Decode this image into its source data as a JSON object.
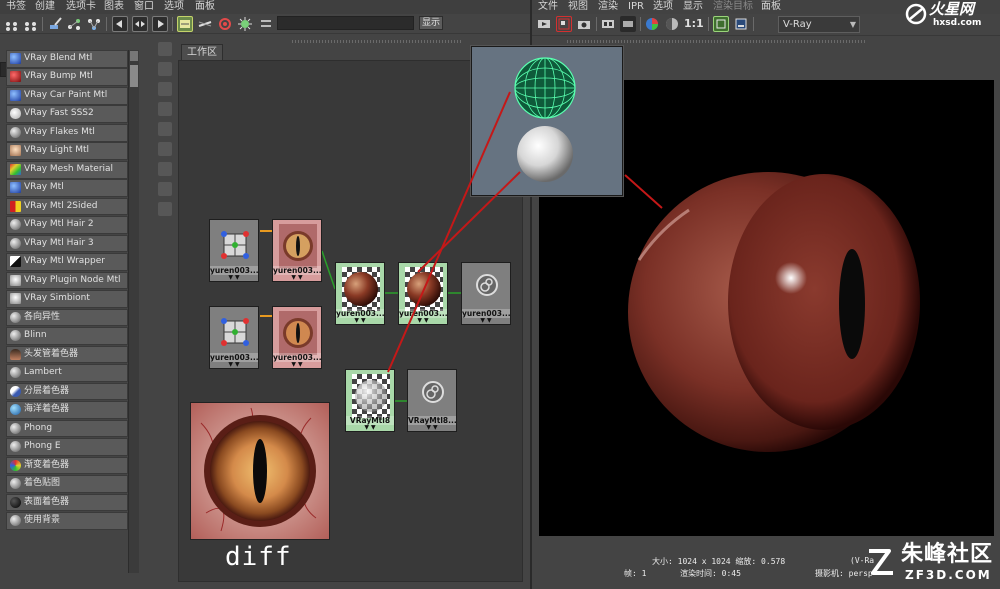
{
  "hypershade": {
    "menu": [
      "书签",
      "创建",
      "选项卡",
      "图表",
      "窗口",
      "选项",
      "面板"
    ],
    "search_button": "显示",
    "workspace_tab": "工作区",
    "shader_list": [
      {
        "label": "VRay Blend Mtl",
        "icon": "blue-sphere-icon"
      },
      {
        "label": "VRay Bump Mtl",
        "icon": "red-bump-icon"
      },
      {
        "label": "VRay Car Paint Mtl",
        "icon": "blue-sphere-icon"
      },
      {
        "label": "VRay Fast SSS2",
        "icon": "cloud-icon"
      },
      {
        "label": "VRay Flakes Mtl",
        "icon": "grey-sphere-icon"
      },
      {
        "label": "VRay Light Mtl",
        "icon": "face-icon"
      },
      {
        "label": "VRay Mesh Material",
        "icon": "rainbow-icon"
      },
      {
        "label": "VRay Mtl",
        "icon": "blue-sphere-icon"
      },
      {
        "label": "VRay Mtl 2Sided",
        "icon": "red-yellow-icon"
      },
      {
        "label": "VRay Mtl Hair 2",
        "icon": "grey-sphere-icon"
      },
      {
        "label": "VRay Mtl Hair 3",
        "icon": "grey-sphere-icon"
      },
      {
        "label": "VRay Mtl Wrapper",
        "icon": "black-white-icon"
      },
      {
        "label": "VRay Plugin Node Mtl",
        "icon": "plugin-icon"
      },
      {
        "label": "VRay Simbiont",
        "icon": "plugin-icon"
      },
      {
        "label": "各向异性",
        "icon": "grey-sphere-icon"
      },
      {
        "label": "Blinn",
        "icon": "grey-sphere-icon"
      },
      {
        "label": "头发管着色器",
        "icon": "hair-tube-icon"
      },
      {
        "label": "Lambert",
        "icon": "grey-sphere-icon"
      },
      {
        "label": "分层着色器",
        "icon": "layered-icon"
      },
      {
        "label": "海洋着色器",
        "icon": "ocean-icon"
      },
      {
        "label": "Phong",
        "icon": "grey-sphere-icon"
      },
      {
        "label": "Phong E",
        "icon": "grey-sphere-icon"
      },
      {
        "label": "渐变着色器",
        "icon": "ramp-icon"
      },
      {
        "label": "着色贴图",
        "icon": "grey-sphere-icon"
      },
      {
        "label": "表面着色器",
        "icon": "black-sphere-icon"
      },
      {
        "label": "使用背景",
        "icon": "grey-sphere-icon"
      }
    ],
    "nodes": [
      {
        "label": "yuren003...",
        "type": "place2d"
      },
      {
        "label": "yuren003...",
        "type": "file-texture"
      },
      {
        "label": "yuren003...",
        "type": "place2d"
      },
      {
        "label": "yuren003...",
        "type": "file-texture"
      },
      {
        "label": "yuren003...",
        "type": "vray-material"
      },
      {
        "label": "yuren003...",
        "type": "vray-material"
      },
      {
        "label": "yuren003...",
        "type": "shading-group"
      },
      {
        "label": "VRayMtl8",
        "type": "vray-material"
      },
      {
        "label": "VRayMtl8...",
        "type": "shading-group"
      }
    ],
    "diff_label": "diff"
  },
  "render_view": {
    "menu": [
      "文件",
      "视图",
      "渲染",
      "IPR",
      "选项",
      "显示",
      "渲染目标",
      "面板"
    ],
    "ratio_label": "1:1",
    "renderer": "V-Ray",
    "info_size": "大小: 1024 x 1024 缩放: 0.578",
    "info_frame": "帧: 1",
    "info_time": "渲染时间: 0:45",
    "info_camera": "摄影机: persp",
    "info_vr": "(V-Ra"
  },
  "watermarks": {
    "top_right": "火星网",
    "top_right_url": "hxsd.com",
    "bottom_right": "朱峰社区",
    "bottom_right_url": "ZF3D.COM"
  },
  "colors": {
    "bg": "#444444",
    "work_area": "#393939",
    "render_bg": "#000000",
    "connection": "#c41818",
    "eye_iris": "#6d2a24"
  }
}
